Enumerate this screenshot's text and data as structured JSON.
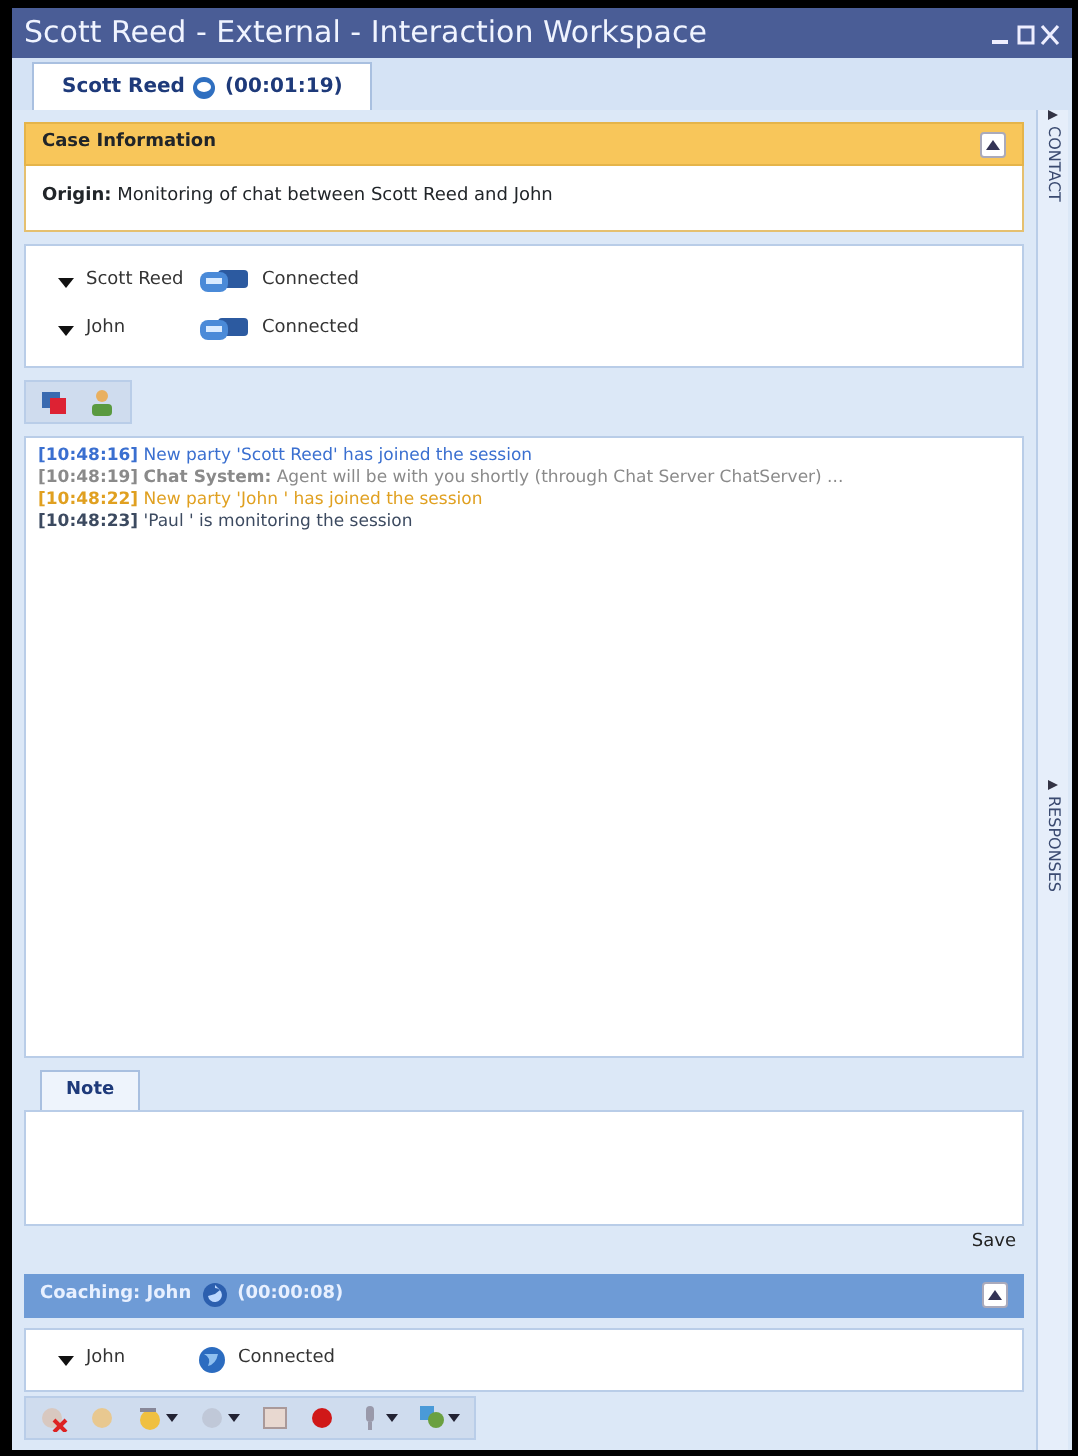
{
  "window": {
    "title": "Scott Reed - External - Interaction Workspace"
  },
  "tabs": [
    {
      "label": "Scott Reed",
      "timer": "(00:01:19)",
      "selected": true
    }
  ],
  "case_information": {
    "title": "Case Information",
    "origin": "**Origin:** Monitoring of chat between Scott Reed and John",
    "expanded": true
  },
  "parties": [
    {
      "name": "Scott Reed",
      "status": "Connected"
    },
    {
      "name": "John",
      "status": "Connected"
    }
  ],
  "transcript": [
    {
      "time": "[10:48:16]",
      "text": "New party 'Scott Reed' has joined the session",
      "color": "#3a6fd0"
    },
    {
      "time": "[10:48:19]",
      "text": "**Chat System:** Agent will be with you shortly (through Chat Server ChatServer) ...",
      "color": "#8a8a8a"
    },
    {
      "time": "[10:48:22]",
      "text": "New party 'John ' has joined the session",
      "color": "#e0a020"
    },
    {
      "time": "[10:48:23]",
      "text": "'Paul ' is monitoring the session",
      "color": "#3c4a60"
    }
  ],
  "note": {
    "tab": "Note",
    "save": "Save"
  },
  "coaching": {
    "title": "Coaching: John",
    "timer": "(00:00:08)",
    "expanded": true,
    "parties": [
      {
        "name": "John",
        "status": "Connected"
      }
    ]
  },
  "side_tabs": [
    {
      "label": "CONTACT"
    },
    {
      "label": "RESPONSES"
    }
  ]
}
